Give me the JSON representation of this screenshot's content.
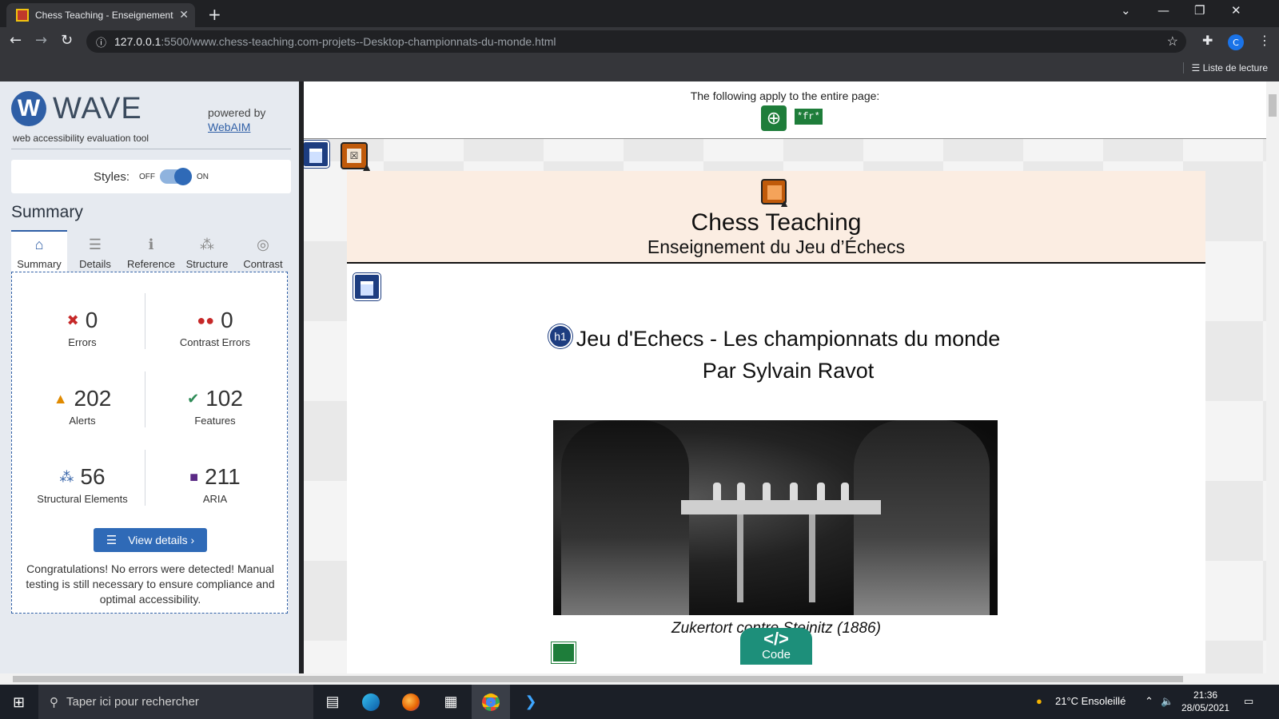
{
  "browser": {
    "tab_title": "Chess Teaching - Enseignement du Jeu d'Échecs",
    "tab_close": "✕",
    "new_tab": "+",
    "url_host": "127.0.0.1",
    "url_path": ":5500/www.chess-teaching.com-projets--Desktop-championnats-du-monde.html",
    "reading_list": "Liste de lecture",
    "profile_initial": "C"
  },
  "wave": {
    "name": "WAVE",
    "tagline": "web accessibility evaluation tool",
    "powered_by": "powered by",
    "webaim": "WebAIM",
    "styles_label": "Styles:",
    "styles_off": "OFF",
    "styles_on": "ON",
    "summary_title": "Summary",
    "tabs": [
      {
        "label": "Summary",
        "icon": "home-icon"
      },
      {
        "label": "Details",
        "icon": "list-icon"
      },
      {
        "label": "Reference",
        "icon": "info-icon"
      },
      {
        "label": "Structure",
        "icon": "structure-icon"
      },
      {
        "label": "Contrast",
        "icon": "contrast-icon"
      }
    ],
    "stats": {
      "errors": {
        "value": "0",
        "label": "Errors"
      },
      "contrast_errors": {
        "value": "0",
        "label": "Contrast Errors"
      },
      "alerts": {
        "value": "202",
        "label": "Alerts"
      },
      "features": {
        "value": "102",
        "label": "Features"
      },
      "structural": {
        "value": "56",
        "label": "Structural Elements"
      },
      "aria": {
        "value": "211",
        "label": "ARIA"
      }
    },
    "view_details": "View details ›",
    "congrats": "Congratulations! No errors were detected! Manual testing is still necessary to ensure compliance and optimal accessibility."
  },
  "page": {
    "apply_text": "The following apply to the entire page:",
    "lang_badge": "*fr*",
    "site_title": "Chess Teaching",
    "site_subtitle": "Enseignement du Jeu d’Échecs",
    "h1_badge": "h1",
    "h1_line1": "Jeu d'Echecs - Les championnats du monde",
    "h1_line2": "Par Sylvain Ravot",
    "caption": "Zukertort contre Steinitz (1886)",
    "code_symbol": "</>",
    "code_label": "Code"
  },
  "taskbar": {
    "search_placeholder": "Taper ici pour rechercher",
    "weather": "21°C  Ensoleillé",
    "time": "21:36",
    "date": "28/05/2021"
  },
  "colors": {
    "wave_blue": "#2f5fa6",
    "feature_green": "#1e7d3a",
    "alert_orange": "#c05a0a",
    "aria_navy": "#1d3d80",
    "header_band": "#fbede2",
    "code_teal": "#1d8f7a"
  }
}
